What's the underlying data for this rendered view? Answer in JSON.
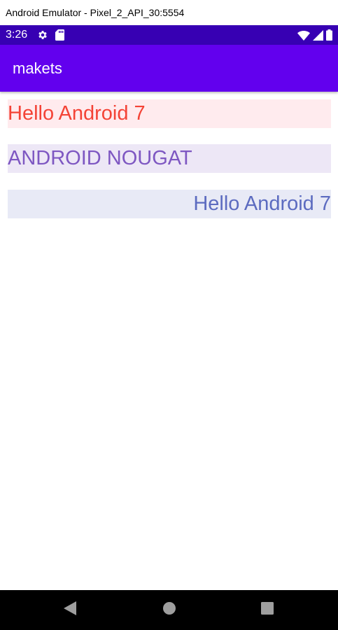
{
  "window": {
    "title": "Android Emulator - Pixel_2_API_30:5554"
  },
  "status_bar": {
    "time": "3:26",
    "left_icons": [
      "gear-icon",
      "sd-card-icon"
    ],
    "right_icons": [
      "wifi-icon",
      "cell-signal-icon",
      "battery-icon"
    ],
    "color": "#3700b3"
  },
  "app_bar": {
    "title": "makets",
    "color": "#6200ee"
  },
  "rows": [
    {
      "text": "Hello Android 7",
      "text_color": "#f44336",
      "background": "#ffebee",
      "align": "left"
    },
    {
      "text": "ANDROID NOUGAT",
      "text_color": "#7e57c2",
      "background": "#ede7f6",
      "align": "left"
    },
    {
      "text": "Hello Android 7",
      "text_color": "#5c6bc0",
      "background": "#e8eaf6",
      "align": "right"
    }
  ],
  "nav_bar": {
    "buttons": [
      "back-icon",
      "home-icon",
      "recents-icon"
    ]
  }
}
